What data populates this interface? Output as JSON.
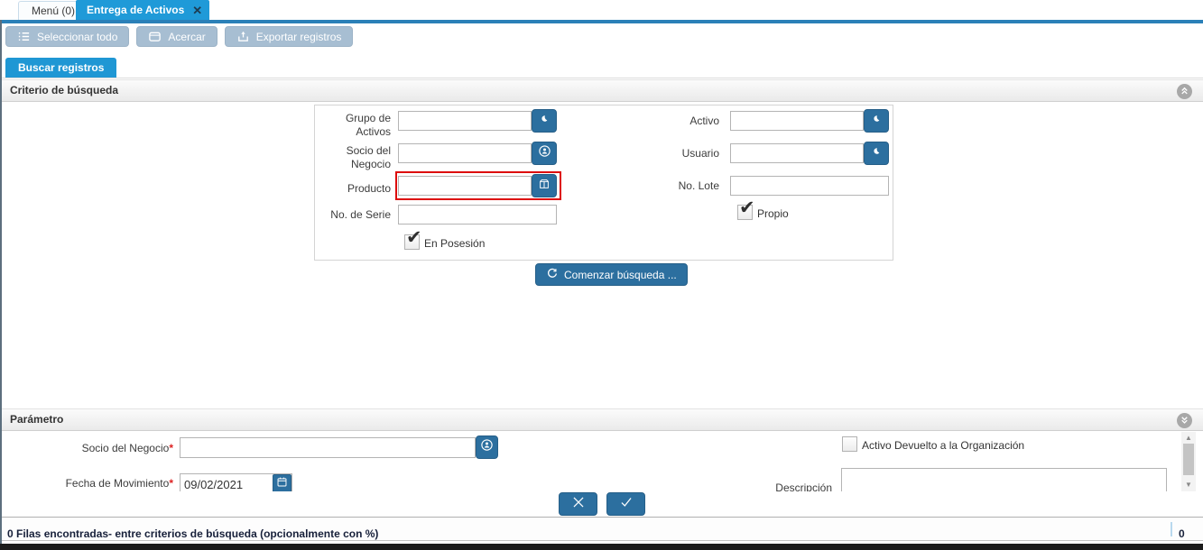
{
  "window": {
    "tab_menu": "Menú (0)",
    "tab_active": "Entrega de Activos"
  },
  "toolbar": {
    "select_all": "Seleccionar todo",
    "zoom": "Acercar",
    "export": "Exportar registros"
  },
  "search": {
    "tab_label": "Buscar registros",
    "criteria_title": "Criterio de búsqueda",
    "fields": {
      "asset_group_label": "Grupo de Activos",
      "asset_group_value": "",
      "bpartner_label": "Socio del Negocio",
      "bpartner_value": "",
      "product_label": "Producto",
      "product_value": "",
      "serial_label": "No. de Serie",
      "serial_value": "",
      "in_possession_label": "En Posesión",
      "in_possession_checked": true,
      "asset_label": "Activo",
      "asset_value": "",
      "user_label": "Usuario",
      "user_value": "",
      "lot_label": "No. Lote",
      "lot_value": "",
      "owned_label": "Propio",
      "owned_checked": true
    },
    "search_button": "Comenzar búsqueda ..."
  },
  "parameter": {
    "title": "Parámetro",
    "bpartner_label": "Socio del Negocio",
    "bpartner_value": "",
    "movement_date_label": "Fecha de Movimiento",
    "movement_date_value": "09/02/2021",
    "asset_returned_label": "Activo Devuelto a la Organización",
    "asset_returned_checked": false,
    "description_label": "Descripción",
    "description_value": "",
    "required_marker": "*"
  },
  "statusbar": {
    "message": "0 Filas encontradas- entre criterios de búsqueda (opcionalmente con %)",
    "count": "0"
  },
  "icons": {
    "tab_close": "✕",
    "checkbox_check": "✔",
    "scroll_up": "▲",
    "scroll_down": "▼"
  },
  "colors": {
    "tab_blue": "#1f9ad8",
    "tab_strip": "#2b80b8",
    "toolbar_button": "#a7bed2",
    "action_button": "#2c6f9f",
    "highlight_red": "#dd0b0b"
  }
}
